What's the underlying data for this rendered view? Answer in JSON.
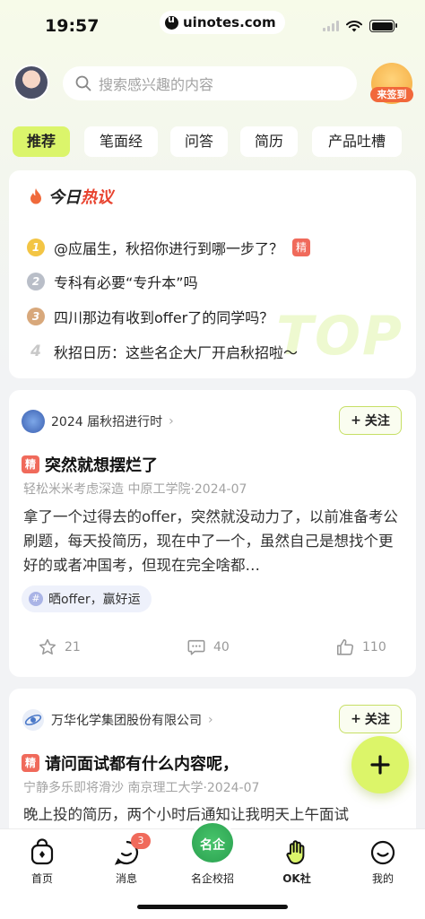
{
  "status_bar": {
    "time": "19:57",
    "site": "uinotes.com"
  },
  "header": {
    "search_placeholder": "搜索感兴趣的内容",
    "signin_label": "来签到"
  },
  "tabs": [
    "推荐",
    "笔面经",
    "问答",
    "简历",
    "产品吐槽"
  ],
  "hot": {
    "title_a": "今日",
    "title_b": "热议",
    "watermark": "TOP",
    "items": [
      {
        "rank": "1",
        "text": "@应届生，秋招你进行到哪一步了？",
        "badge": "精"
      },
      {
        "rank": "2",
        "text": "专科有必要“专升本”吗"
      },
      {
        "rank": "3",
        "text": "四川那边有收到offer了的同学吗？"
      },
      {
        "rank": "4",
        "text": "秋招日历：这些名企大厂开启秋招啦～"
      }
    ]
  },
  "posts": [
    {
      "topic": "2024 届秋招进行时",
      "follow": "关注",
      "badge": "精",
      "title": "突然就想摆烂了",
      "meta": "轻松米米考虑深造   中原工学院·2024-07",
      "body": "拿了一个过得去的offer，突然就没动力了，以前准备考公刷题，每天投简历，现在中了一个，虽然自己是想找个更好的或者冲国考，但现在完全啥都…",
      "tag": "晒offer，赢好运",
      "likes": "21",
      "comments": "40",
      "thumbs": "110"
    },
    {
      "topic": "万华化学集团股份有限公司",
      "follow": "关注",
      "badge": "精",
      "title": "请问面试都有什么内容呢，",
      "meta": "宁静多乐即将滑沙   南京理工大学·2024-07",
      "body": "晚上投的简历，两个小时后通知让我明天上午面试"
    }
  ],
  "bottom_nav": {
    "home": "首页",
    "messages": "消息",
    "messages_badge": "3",
    "mq_logo": "名企",
    "mq": "名企校招",
    "ok": "OK社",
    "me": "我的"
  },
  "colors": {
    "accent": "#dbf56b",
    "red": "#e8432f",
    "badge": "#f06a5b"
  }
}
